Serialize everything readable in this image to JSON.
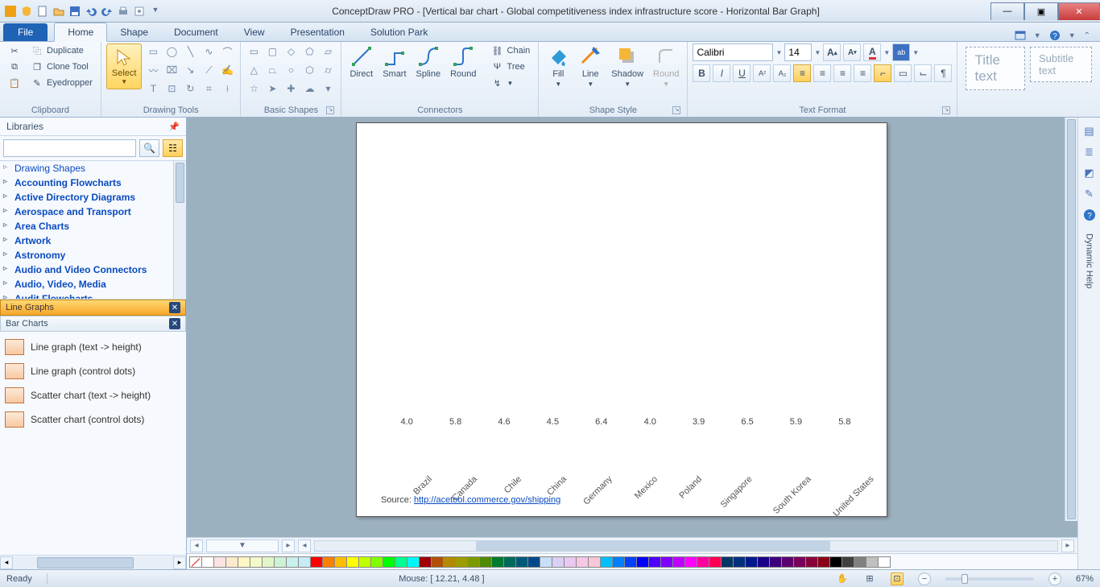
{
  "window": {
    "title": "ConceptDraw PRO - [Vertical bar chart - Global competitiveness index infrastructure score - Horizontal Bar Graph]"
  },
  "tabs": {
    "file": "File",
    "items": [
      "Home",
      "Shape",
      "Document",
      "View",
      "Presentation",
      "Solution Park"
    ],
    "active": "Home"
  },
  "ribbon": {
    "clipboard": {
      "label": "Clipboard",
      "duplicate": "Duplicate",
      "clone": "Clone Tool",
      "eyedropper": "Eyedropper"
    },
    "drawing": {
      "label": "Drawing Tools",
      "select": "Select"
    },
    "basic_shapes": {
      "label": "Basic Shapes"
    },
    "connectors": {
      "label": "Connectors",
      "direct": "Direct",
      "smart": "Smart",
      "spline": "Spline",
      "round": "Round",
      "chain": "Chain",
      "tree": "Tree"
    },
    "shape_style": {
      "label": "Shape Style",
      "fill": "Fill",
      "line": "Line",
      "shadow": "Shadow",
      "round": "Round"
    },
    "text_format": {
      "label": "Text Format",
      "font": "Calibri",
      "size": "14"
    },
    "title_text": "Title text",
    "subtitle_text": "Subtitle text"
  },
  "sidebar": {
    "title": "Libraries",
    "tree": [
      "Drawing Shapes",
      "Accounting Flowcharts",
      "Active Directory Diagrams",
      "Aerospace and Transport",
      "Area Charts",
      "Artwork",
      "Astronomy",
      "Audio and Video Connectors",
      "Audio, Video, Media",
      "Audit Flowcharts"
    ],
    "section1": "Line Graphs",
    "section2": "Bar Charts",
    "shapes": [
      "Line graph (text -> height)",
      "Line graph (control dots)",
      "Scatter chart (text -> height)",
      "Scatter chart (control dots)"
    ]
  },
  "rstrip": {
    "dynamic_help": "Dynamic Help"
  },
  "status": {
    "ready": "Ready",
    "mouse": "Mouse: [ 12.21, 4.48 ]",
    "zoom": "67%"
  },
  "source": {
    "label": "Source:",
    "url": "http://acetool.commerce.gov/shipping"
  },
  "chart_data": {
    "type": "bar",
    "categories": [
      "Brazil",
      "Canada",
      "Chile",
      "China",
      "Germany",
      "Mexico",
      "Poland",
      "Singapore",
      "South Korea",
      "United States"
    ],
    "values": [
      4.0,
      5.8,
      4.6,
      4.5,
      6.4,
      4.0,
      3.9,
      6.5,
      5.9,
      5.8
    ],
    "highlight_index": 9,
    "ylim": [
      0,
      7
    ],
    "title": "",
    "xlabel": "",
    "ylabel": ""
  },
  "palette": [
    "#ffffff",
    "#fde3e3",
    "#fceacd",
    "#fff6c6",
    "#f3f9c9",
    "#e1f5cb",
    "#cff2d7",
    "#c9f0ea",
    "#c8ecf6",
    "#ff0000",
    "#ff7f00",
    "#ffbf00",
    "#ffff00",
    "#bfff00",
    "#7fff00",
    "#00ff00",
    "#00ff90",
    "#00f7f7",
    "#a00000",
    "#b05000",
    "#b28a00",
    "#9c9c00",
    "#7b9a00",
    "#4f8a00",
    "#007a2f",
    "#006a5a",
    "#005a77",
    "#004a8a",
    "#c9dff9",
    "#d9d0f3",
    "#e9c9ef",
    "#f6c8e6",
    "#f8c8d6",
    "#00bfff",
    "#007fff",
    "#0040ff",
    "#0000ff",
    "#4d00ff",
    "#8000ff",
    "#bf00ff",
    "#ff00ff",
    "#ff00a0",
    "#ff0055",
    "#003766",
    "#002f7d",
    "#00188a",
    "#1b008a",
    "#3c007d",
    "#5c006d",
    "#77005a",
    "#8a003a",
    "#8a0016",
    "#000000",
    "#404040",
    "#808080",
    "#c0c0c0",
    "#ffffff"
  ]
}
